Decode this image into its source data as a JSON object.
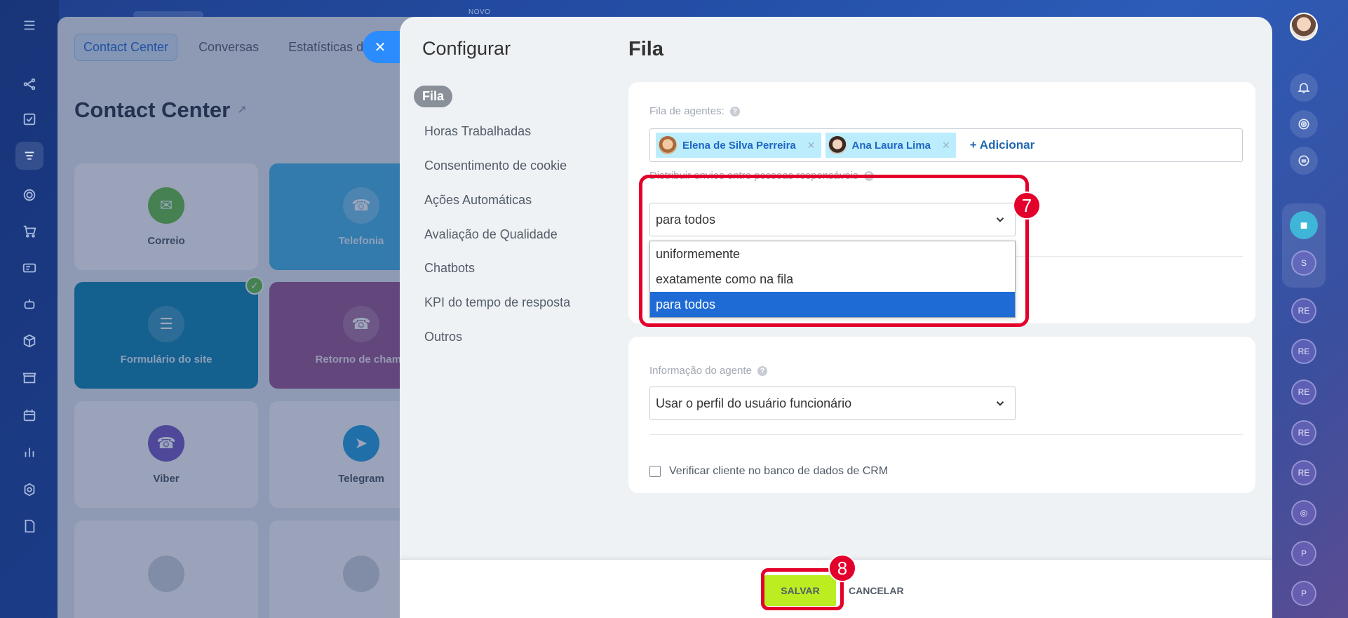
{
  "background": {
    "novo_label": "NOVO",
    "tabs": [
      "Contact Center",
      "Conversas",
      "Estatísticas de c"
    ],
    "page_title": "Contact Center",
    "tiles": [
      {
        "label": "Correio",
        "icon": "mail-icon"
      },
      {
        "label": "Telefonia",
        "icon": "phone-icon"
      },
      {
        "label": "Formulário do site",
        "icon": "form-icon"
      },
      {
        "label": "Retorno de chama",
        "icon": "callback-icon"
      },
      {
        "label": "Viber",
        "icon": "viber-icon"
      },
      {
        "label": "Telegram",
        "icon": "telegram-icon"
      }
    ]
  },
  "config": {
    "title": "Configurar",
    "menu": [
      "Fila",
      "Horas Trabalhadas",
      "Consentimento de cookie",
      "Ações Automáticas",
      "Avaliação de Qualidade",
      "Chatbots",
      "KPI do tempo de resposta",
      "Outros"
    ],
    "active_menu": "Fila"
  },
  "main": {
    "heading": "Fila",
    "queue_label": "Fila de agentes:",
    "agents": [
      "Elena de Silva Perreira",
      "Ana Laura Lima"
    ],
    "add_label": "+ Adicionar",
    "distribute_label": "Distribuir envios entre pessoas responsáveis",
    "distribute_value": "para todos",
    "distribute_options": [
      "uniformemente",
      "exatamente como na fila",
      "para todos"
    ],
    "distribute_selected_index": 2,
    "agent_info_label": "Informação do agente",
    "agent_info_value": "Usar o perfil do usuário funcionário",
    "crm_check_label": "Verificar cliente no banco de dados de CRM",
    "crm_checked": false
  },
  "footer": {
    "save_label": "SALVAR",
    "cancel_label": "CANCELAR"
  },
  "annotations": {
    "marker_7": "7",
    "marker_8": "8"
  },
  "right_rail": {
    "chips": [
      "S",
      "RE",
      "RE",
      "RE",
      "RE",
      "RE",
      "P",
      "P"
    ]
  },
  "colors": {
    "accent_blue": "#2b8cff",
    "save_green": "#bbed21",
    "selected_option": "#1e6bd6",
    "annotation_red": "#e3002b"
  }
}
